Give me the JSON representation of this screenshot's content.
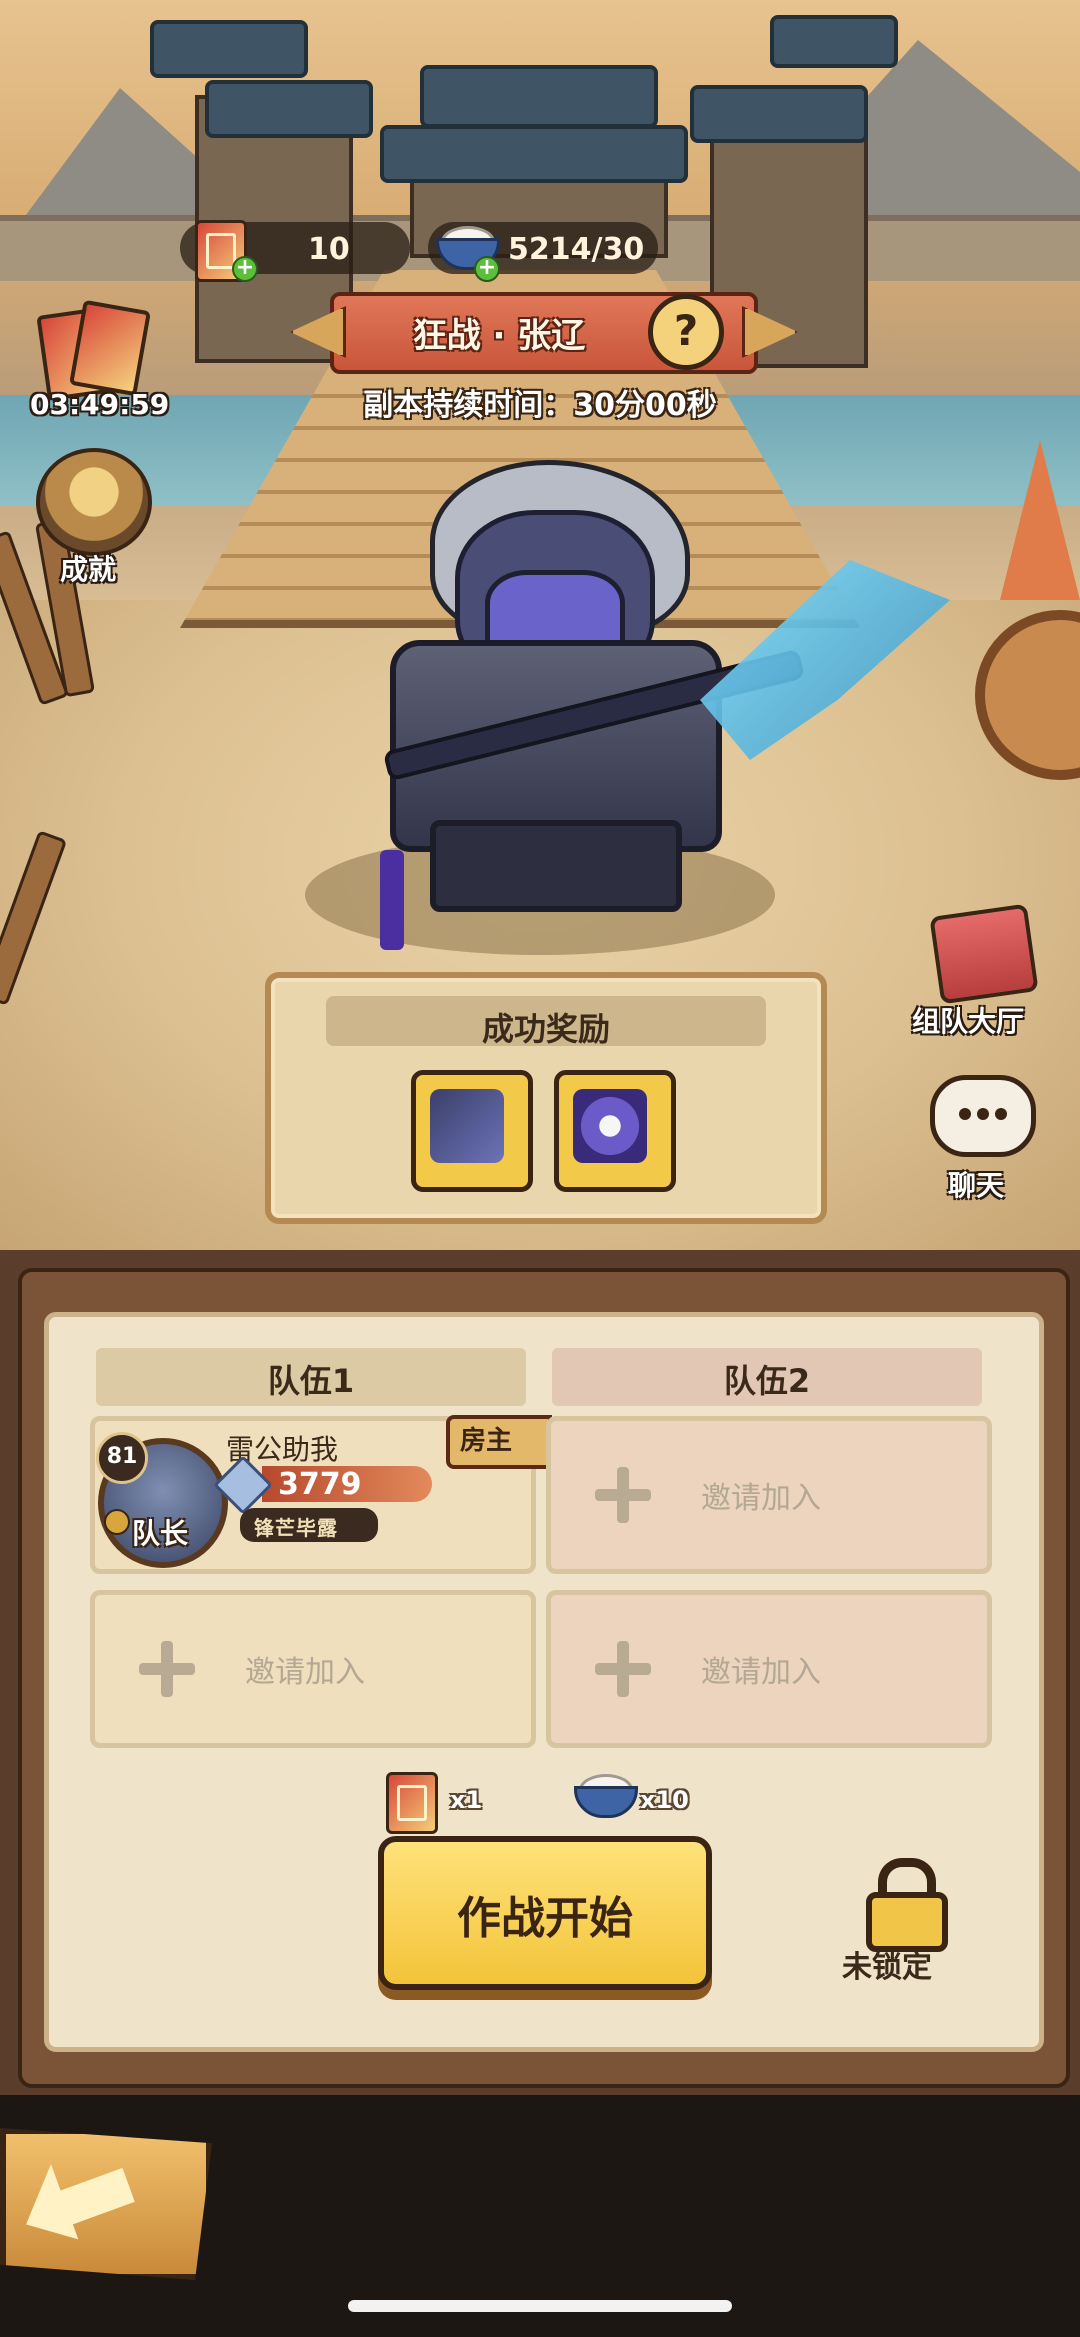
{
  "resources": {
    "cards_count": "10",
    "rice_count": "5214/30"
  },
  "left_icons": {
    "timer": "03:49:59",
    "achievements_label": "成就"
  },
  "boss": {
    "title": "狂战 · 张辽",
    "duration_text": "副本持续时间：30分00秒"
  },
  "rewards": {
    "title": "成功奖励",
    "items": [
      "armor-reward-icon",
      "portal-chest-icon"
    ]
  },
  "right_icons": {
    "team_hall_label": "组队大厅",
    "chat_label": "聊天"
  },
  "teams": {
    "team1_title": "队伍1",
    "team2_title": "队伍2",
    "member": {
      "level": "81",
      "name": "雷公助我",
      "power": "3779",
      "title": "锋芒毕露",
      "role": "队长",
      "host_tag": "房主"
    },
    "invite_label": "邀请加入"
  },
  "cost": {
    "cards": "x1",
    "rice": "x10"
  },
  "actions": {
    "start_label": "作战开始",
    "lock_label": "未锁定"
  },
  "colors": {
    "accent_yellow": "#f3c43a",
    "banner_red": "#c9563a",
    "panel_paper": "#efe3c9",
    "frame_brown": "#7b5438"
  }
}
